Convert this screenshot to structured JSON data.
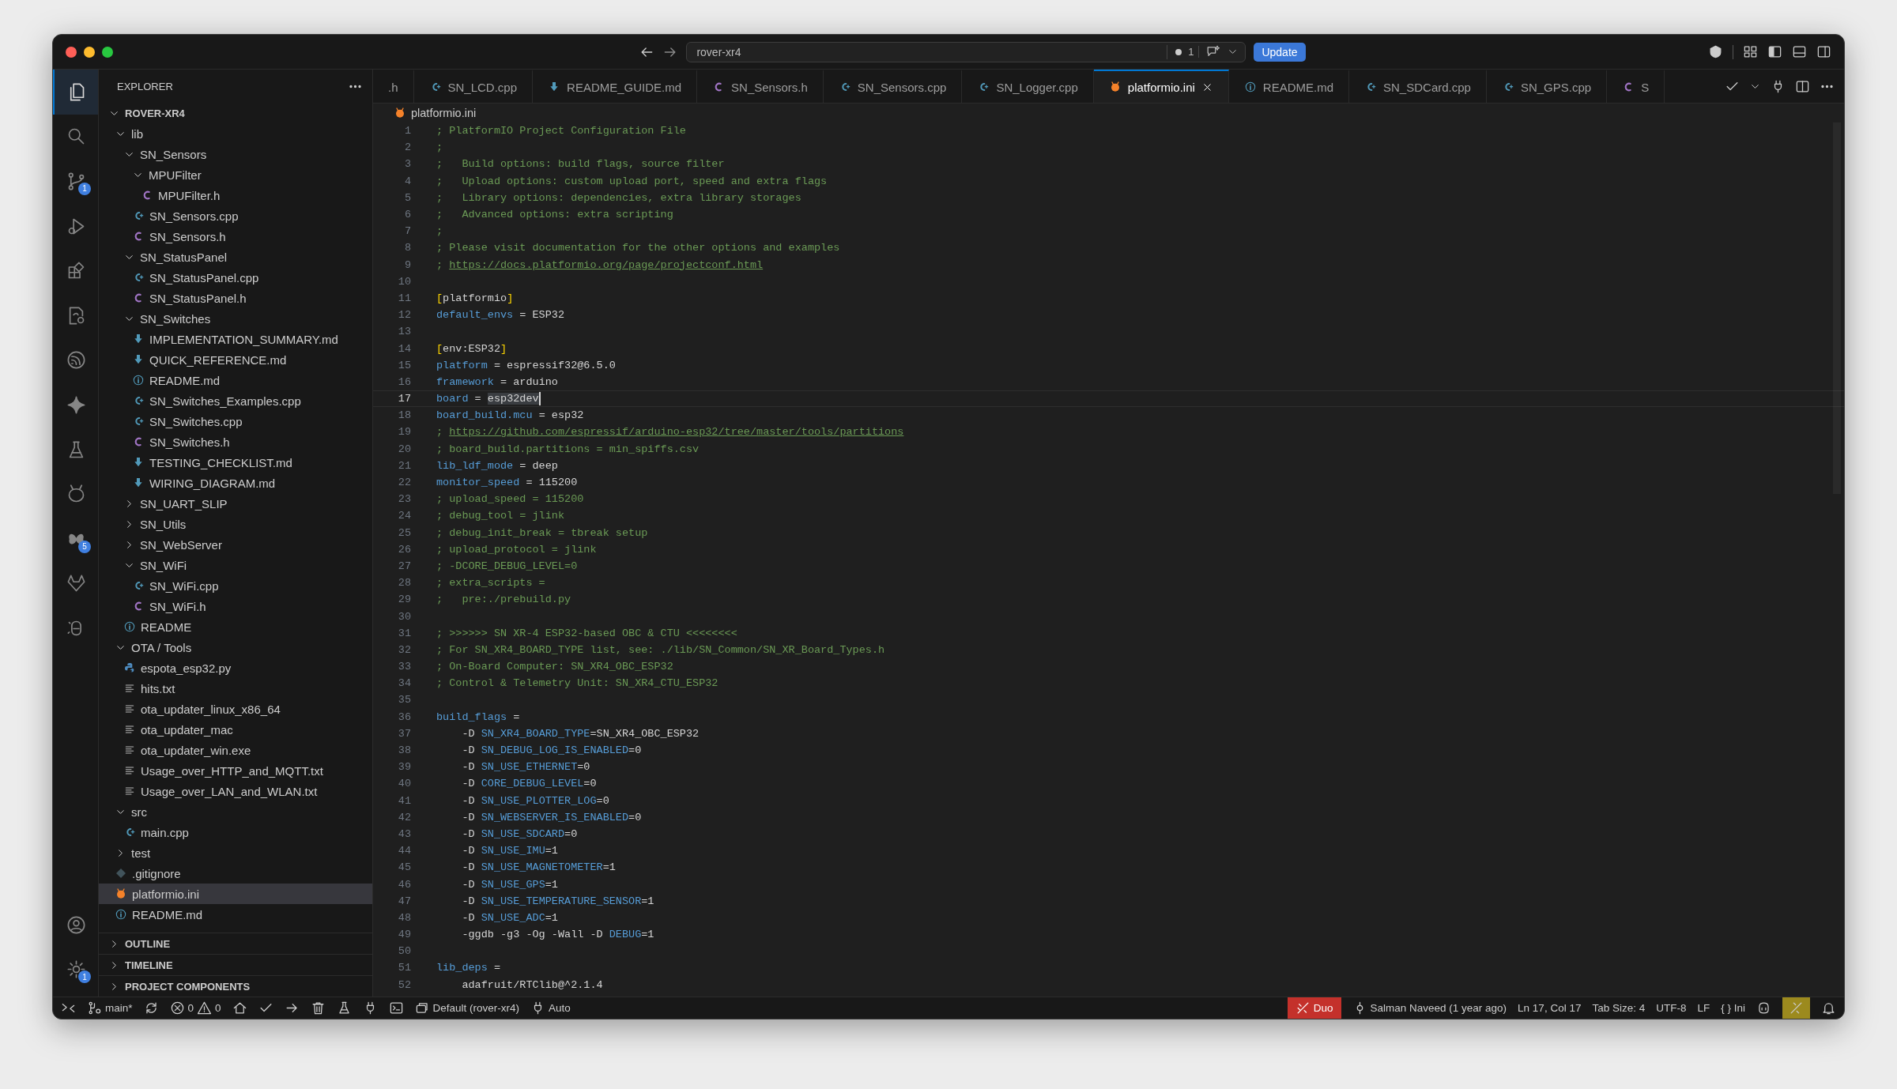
{
  "title_bar": {
    "search": {
      "value": "rover-xr4"
    },
    "changes": "1",
    "update": "Update"
  },
  "activity_bar": {
    "top": [
      {
        "kind": "files",
        "selected": true
      },
      {
        "kind": "search",
        "selected": false
      },
      {
        "kind": "source-control",
        "selected": false,
        "badge": "1"
      },
      {
        "kind": "run",
        "selected": false
      },
      {
        "kind": "extensions",
        "selected": false
      },
      {
        "kind": "remote",
        "selected": false
      },
      {
        "kind": "espressif",
        "selected": false
      },
      {
        "kind": "sparkle",
        "selected": false
      },
      {
        "kind": "flask",
        "selected": false
      },
      {
        "kind": "alien",
        "selected": false
      },
      {
        "kind": "butterfly",
        "selected": false,
        "badge": "5"
      },
      {
        "kind": "fox",
        "selected": false
      },
      {
        "kind": "assistant",
        "selected": false
      }
    ],
    "bottom": [
      {
        "kind": "account",
        "selected": false
      },
      {
        "kind": "settings",
        "selected": false,
        "badge": "1"
      }
    ]
  },
  "explorer": {
    "title": "EXPLORER",
    "root": {
      "name": "ROVER-XR4",
      "expanded": true
    },
    "tree": [
      {
        "name": "lib",
        "kind": "folder",
        "expanded": true,
        "selected": false,
        "children": [
          {
            "name": "SN_Sensors",
            "kind": "folder",
            "expanded": true,
            "selected": false,
            "children": [
              {
                "name": "MPUFilter",
                "kind": "folder",
                "expanded": true,
                "selected": false,
                "children": [
                  {
                    "name": "MPUFilter.h",
                    "kind": "h",
                    "selected": false
                  }
                ]
              },
              {
                "name": "SN_Sensors.cpp",
                "kind": "cpp",
                "selected": false
              },
              {
                "name": "SN_Sensors.h",
                "kind": "h",
                "selected": false
              }
            ]
          },
          {
            "name": "SN_StatusPanel",
            "kind": "folder",
            "expanded": true,
            "selected": false,
            "children": [
              {
                "name": "SN_StatusPanel.cpp",
                "kind": "cpp",
                "selected": false
              },
              {
                "name": "SN_StatusPanel.h",
                "kind": "h",
                "selected": false
              }
            ]
          },
          {
            "name": "SN_Switches",
            "kind": "folder",
            "expanded": true,
            "selected": false,
            "children": [
              {
                "name": "IMPLEMENTATION_SUMMARY.md",
                "kind": "md",
                "selected": false
              },
              {
                "name": "QUICK_REFERENCE.md",
                "kind": "md",
                "selected": false
              },
              {
                "name": "README.md",
                "kind": "info",
                "selected": false
              },
              {
                "name": "SN_Switches_Examples.cpp",
                "kind": "cpp",
                "selected": false
              },
              {
                "name": "SN_Switches.cpp",
                "kind": "cpp",
                "selected": false
              },
              {
                "name": "SN_Switches.h",
                "kind": "h",
                "selected": false
              },
              {
                "name": "TESTING_CHECKLIST.md",
                "kind": "md",
                "selected": false
              },
              {
                "name": "WIRING_DIAGRAM.md",
                "kind": "md",
                "selected": false
              }
            ]
          },
          {
            "name": "SN_UART_SLIP",
            "kind": "folder",
            "expanded": false,
            "selected": false
          },
          {
            "name": "SN_Utils",
            "kind": "folder",
            "expanded": false,
            "selected": false
          },
          {
            "name": "SN_WebServer",
            "kind": "folder",
            "expanded": false,
            "selected": false
          },
          {
            "name": "SN_WiFi",
            "kind": "folder",
            "expanded": true,
            "selected": false,
            "children": [
              {
                "name": "SN_WiFi.cpp",
                "kind": "cpp",
                "selected": false
              },
              {
                "name": "SN_WiFi.h",
                "kind": "h",
                "selected": false
              }
            ]
          },
          {
            "name": "README",
            "kind": "info",
            "selected": false
          }
        ]
      },
      {
        "name": "OTA / Tools",
        "kind": "folder",
        "expanded": true,
        "selected": false,
        "children": [
          {
            "name": "espota_esp32.py",
            "kind": "py",
            "selected": false
          },
          {
            "name": "hits.txt",
            "kind": "txt",
            "selected": false
          },
          {
            "name": "ota_updater_linux_x86_64",
            "kind": "txt",
            "selected": false
          },
          {
            "name": "ota_updater_mac",
            "kind": "txt",
            "selected": false
          },
          {
            "name": "ota_updater_win.exe",
            "kind": "txt",
            "selected": false
          },
          {
            "name": "Usage_over_HTTP_and_MQTT.txt",
            "kind": "txt",
            "selected": false
          },
          {
            "name": "Usage_over_LAN_and_WLAN.txt",
            "kind": "txt",
            "selected": false
          }
        ]
      },
      {
        "name": "src",
        "kind": "folder",
        "expanded": true,
        "selected": false,
        "children": [
          {
            "name": "main.cpp",
            "kind": "cpp",
            "selected": false
          }
        ]
      },
      {
        "name": "test",
        "kind": "folder",
        "expanded": false,
        "selected": false
      },
      {
        "name": ".gitignore",
        "kind": "git",
        "selected": false
      },
      {
        "name": "platformio.ini",
        "kind": "pio",
        "selected": true
      },
      {
        "name": "README.md",
        "kind": "info",
        "selected": false
      }
    ],
    "sections": [
      {
        "label": "OUTLINE",
        "expanded": false
      },
      {
        "label": "TIMELINE",
        "expanded": false
      },
      {
        "label": "PROJECT COMPONENTS",
        "expanded": false
      }
    ]
  },
  "tabs": [
    {
      "label": ".h",
      "selected": false
    },
    {
      "label": "SN_LCD.cpp",
      "kind": "cpp",
      "selected": false
    },
    {
      "label": "README_GUIDE.md",
      "kind": "md",
      "selected": false
    },
    {
      "label": "SN_Sensors.h",
      "kind": "h",
      "selected": false
    },
    {
      "label": "SN_Sensors.cpp",
      "kind": "cpp",
      "selected": false
    },
    {
      "label": "SN_Logger.cpp",
      "kind": "cpp",
      "selected": false
    },
    {
      "label": "platformio.ini",
      "kind": "pio",
      "selected": true
    },
    {
      "label": "README.md",
      "kind": "info",
      "selected": false
    },
    {
      "label": "SN_SDCard.cpp",
      "kind": "cpp",
      "selected": false
    },
    {
      "label": "SN_GPS.cpp",
      "kind": "cpp",
      "selected": false
    },
    {
      "label": "S",
      "kind": "h",
      "selected": false
    }
  ],
  "breadcrumb": {
    "kind": "pio",
    "label": "platformio.ini"
  },
  "code": [
    {
      "n": "1",
      "current": false,
      "tokens": [
        {
          "kind": "comment",
          "text": "; PlatformIO Project Configuration File"
        }
      ]
    },
    {
      "n": "2",
      "current": false,
      "tokens": [
        {
          "kind": "comment",
          "text": ";"
        }
      ]
    },
    {
      "n": "3",
      "current": false,
      "tokens": [
        {
          "kind": "comment",
          "text": ";   Build options: build flags, source filter"
        }
      ]
    },
    {
      "n": "4",
      "current": false,
      "tokens": [
        {
          "kind": "comment",
          "text": ";   Upload options: custom upload port, speed and extra flags"
        }
      ]
    },
    {
      "n": "5",
      "current": false,
      "tokens": [
        {
          "kind": "comment",
          "text": ";   Library options: dependencies, extra library storages"
        }
      ]
    },
    {
      "n": "6",
      "current": false,
      "tokens": [
        {
          "kind": "comment",
          "text": ";   Advanced options: extra scripting"
        }
      ]
    },
    {
      "n": "7",
      "current": false,
      "tokens": [
        {
          "kind": "comment",
          "text": ";"
        }
      ]
    },
    {
      "n": "8",
      "current": false,
      "tokens": [
        {
          "kind": "comment",
          "text": "; Please visit documentation for the other options and examples"
        }
      ]
    },
    {
      "n": "9",
      "current": false,
      "tokens": [
        {
          "kind": "comment",
          "text": "; "
        },
        {
          "kind": "link",
          "text": "https://docs.platformio.org/page/projectconf.html"
        }
      ]
    },
    {
      "n": "10",
      "current": false
    },
    {
      "n": "11",
      "current": false,
      "tokens": [
        {
          "kind": "bracket",
          "text": "["
        },
        {
          "kind": "plain",
          "text": "platformio"
        },
        {
          "kind": "bracket",
          "text": "]"
        }
      ]
    },
    {
      "n": "12",
      "current": false,
      "tokens": [
        {
          "kind": "key",
          "text": "default_envs"
        },
        {
          "kind": "plain",
          "text": " = ESP32"
        }
      ]
    },
    {
      "n": "13",
      "current": false
    },
    {
      "n": "14",
      "current": false,
      "tokens": [
        {
          "kind": "bracket",
          "text": "["
        },
        {
          "kind": "plain",
          "text": "env:ESP32"
        },
        {
          "kind": "bracket",
          "text": "]"
        }
      ]
    },
    {
      "n": "15",
      "current": false,
      "tokens": [
        {
          "kind": "key",
          "text": "platform"
        },
        {
          "kind": "plain",
          "text": " = espressif32@6.5.0"
        }
      ]
    },
    {
      "n": "16",
      "current": false,
      "tokens": [
        {
          "kind": "key",
          "text": "framework"
        },
        {
          "kind": "plain",
          "text": " = arduino"
        }
      ]
    },
    {
      "n": "17",
      "current": true,
      "tokens": [
        {
          "kind": "key",
          "text": "board"
        },
        {
          "kind": "plain",
          "text": " = "
        },
        {
          "kind": "selection",
          "text": "esp32dev"
        }
      ]
    },
    {
      "n": "18",
      "current": false,
      "tokens": [
        {
          "kind": "key",
          "text": "board_build.mcu"
        },
        {
          "kind": "plain",
          "text": " = esp32"
        }
      ]
    },
    {
      "n": "19",
      "current": false,
      "tokens": [
        {
          "kind": "comment",
          "text": "; "
        },
        {
          "kind": "link",
          "text": "https://github.com/espressif/arduino-esp32/tree/master/tools/partitions"
        }
      ]
    },
    {
      "n": "20",
      "current": false,
      "tokens": [
        {
          "kind": "comment",
          "text": "; board_build.partitions = min_spiffs.csv"
        }
      ]
    },
    {
      "n": "21",
      "current": false,
      "tokens": [
        {
          "kind": "key",
          "text": "lib_ldf_mode"
        },
        {
          "kind": "plain",
          "text": " = deep"
        }
      ]
    },
    {
      "n": "22",
      "current": false,
      "tokens": [
        {
          "kind": "key",
          "text": "monitor_speed"
        },
        {
          "kind": "plain",
          "text": " = 115200"
        }
      ]
    },
    {
      "n": "23",
      "current": false,
      "tokens": [
        {
          "kind": "comment",
          "text": "; upload_speed = 115200"
        }
      ]
    },
    {
      "n": "24",
      "current": false,
      "tokens": [
        {
          "kind": "comment",
          "text": "; debug_tool = jlink"
        }
      ]
    },
    {
      "n": "25",
      "current": false,
      "tokens": [
        {
          "kind": "comment",
          "text": "; debug_init_break = tbreak setup"
        }
      ]
    },
    {
      "n": "26",
      "current": false,
      "tokens": [
        {
          "kind": "comment",
          "text": "; upload_protocol = jlink"
        }
      ]
    },
    {
      "n": "27",
      "current": false,
      "tokens": [
        {
          "kind": "comment",
          "text": "; -DCORE_DEBUG_LEVEL=0"
        }
      ]
    },
    {
      "n": "28",
      "current": false,
      "tokens": [
        {
          "kind": "comment",
          "text": "; extra_scripts ="
        }
      ]
    },
    {
      "n": "29",
      "current": false,
      "tokens": [
        {
          "kind": "comment",
          "text": ";   pre:./prebuild.py"
        }
      ]
    },
    {
      "n": "30",
      "current": false
    },
    {
      "n": "31",
      "current": false,
      "tokens": [
        {
          "kind": "comment",
          "text": "; >>>>>> SN XR-4 ESP32-based OBC & CTU <<<<<<<<"
        }
      ]
    },
    {
      "n": "32",
      "current": false,
      "tokens": [
        {
          "kind": "comment",
          "text": "; For SN_XR4_BOARD_TYPE list, see: ./lib/SN_Common/SN_XR_Board_Types.h"
        }
      ]
    },
    {
      "n": "33",
      "current": false,
      "tokens": [
        {
          "kind": "comment",
          "text": "; On-Board Computer: SN_XR4_OBC_ESP32"
        }
      ]
    },
    {
      "n": "34",
      "current": false,
      "tokens": [
        {
          "kind": "comment",
          "text": "; Control & Telemetry Unit: SN_XR4_CTU_ESP32"
        }
      ]
    },
    {
      "n": "35",
      "current": false
    },
    {
      "n": "36",
      "current": false,
      "tokens": [
        {
          "kind": "key",
          "text": "build_flags"
        },
        {
          "kind": "plain",
          "text": " ="
        }
      ]
    },
    {
      "n": "37",
      "current": false,
      "tokens": [
        {
          "kind": "plain",
          "text": "    -D "
        },
        {
          "kind": "key",
          "text": "SN_XR4_BOARD_TYPE"
        },
        {
          "kind": "plain",
          "text": "=SN_XR4_OBC_ESP32"
        }
      ]
    },
    {
      "n": "38",
      "current": false,
      "tokens": [
        {
          "kind": "plain",
          "text": "    -D "
        },
        {
          "kind": "key",
          "text": "SN_DEBUG_LOG_IS_ENABLED"
        },
        {
          "kind": "plain",
          "text": "=0"
        }
      ]
    },
    {
      "n": "39",
      "current": false,
      "tokens": [
        {
          "kind": "plain",
          "text": "    -D "
        },
        {
          "kind": "key",
          "text": "SN_USE_ETHERNET"
        },
        {
          "kind": "plain",
          "text": "=0"
        }
      ]
    },
    {
      "n": "40",
      "current": false,
      "tokens": [
        {
          "kind": "plain",
          "text": "    -D "
        },
        {
          "kind": "key",
          "text": "CORE_DEBUG_LEVEL"
        },
        {
          "kind": "plain",
          "text": "=0"
        }
      ]
    },
    {
      "n": "41",
      "current": false,
      "tokens": [
        {
          "kind": "plain",
          "text": "    -D "
        },
        {
          "kind": "key",
          "text": "SN_USE_PLOTTER_LOG"
        },
        {
          "kind": "plain",
          "text": "=0"
        }
      ]
    },
    {
      "n": "42",
      "current": false,
      "tokens": [
        {
          "kind": "plain",
          "text": "    -D "
        },
        {
          "kind": "key",
          "text": "SN_WEBSERVER_IS_ENABLED"
        },
        {
          "kind": "plain",
          "text": "=0"
        }
      ]
    },
    {
      "n": "43",
      "current": false,
      "tokens": [
        {
          "kind": "plain",
          "text": "    -D "
        },
        {
          "kind": "key",
          "text": "SN_USE_SDCARD"
        },
        {
          "kind": "plain",
          "text": "=0"
        }
      ]
    },
    {
      "n": "44",
      "current": false,
      "tokens": [
        {
          "kind": "plain",
          "text": "    -D "
        },
        {
          "kind": "key",
          "text": "SN_USE_IMU"
        },
        {
          "kind": "plain",
          "text": "=1"
        }
      ]
    },
    {
      "n": "45",
      "current": false,
      "tokens": [
        {
          "kind": "plain",
          "text": "    -D "
        },
        {
          "kind": "key",
          "text": "SN_USE_MAGNETOMETER"
        },
        {
          "kind": "plain",
          "text": "=1"
        }
      ]
    },
    {
      "n": "46",
      "current": false,
      "tokens": [
        {
          "kind": "plain",
          "text": "    -D "
        },
        {
          "kind": "key",
          "text": "SN_USE_GPS"
        },
        {
          "kind": "plain",
          "text": "=1"
        }
      ]
    },
    {
      "n": "47",
      "current": false,
      "tokens": [
        {
          "kind": "plain",
          "text": "    -D "
        },
        {
          "kind": "key",
          "text": "SN_USE_TEMPERATURE_SENSOR"
        },
        {
          "kind": "plain",
          "text": "=1"
        }
      ]
    },
    {
      "n": "48",
      "current": false,
      "tokens": [
        {
          "kind": "plain",
          "text": "    -D "
        },
        {
          "kind": "key",
          "text": "SN_USE_ADC"
        },
        {
          "kind": "plain",
          "text": "=1"
        }
      ]
    },
    {
      "n": "49",
      "current": false,
      "tokens": [
        {
          "kind": "plain",
          "text": "    -ggdb -g3 -Og -Wall -D "
        },
        {
          "kind": "key",
          "text": "DEBUG"
        },
        {
          "kind": "plain",
          "text": "=1"
        }
      ]
    },
    {
      "n": "50",
      "current": false
    },
    {
      "n": "51",
      "current": false,
      "tokens": [
        {
          "kind": "key",
          "text": "lib_deps"
        },
        {
          "kind": "plain",
          "text": " ="
        }
      ]
    },
    {
      "n": "52",
      "current": false,
      "tokens": [
        {
          "kind": "plain",
          "text": "    adafruit/RTClib@^2.1.4"
        }
      ]
    }
  ],
  "status_bar": {
    "left": [
      {
        "kind": "remote"
      },
      {
        "kind": "branch",
        "text": "main*"
      },
      {
        "kind": "sync"
      },
      {
        "kind": "problems",
        "errors": "0",
        "warnings": "0"
      },
      {
        "kind": "home"
      },
      {
        "kind": "check"
      },
      {
        "kind": "arrow"
      },
      {
        "kind": "trash"
      },
      {
        "kind": "flask"
      },
      {
        "kind": "plug"
      },
      {
        "kind": "terminal"
      },
      {
        "kind": "env",
        "text": "Default (rover-xr4)"
      },
      {
        "kind": "port",
        "text": "Auto"
      }
    ],
    "right": [
      {
        "kind": "duo",
        "text": "Duo"
      },
      {
        "kind": "blame",
        "text": "Salman Naveed (1 year ago)"
      },
      {
        "kind": "plain",
        "text": "Ln 17, Col 17"
      },
      {
        "kind": "plain",
        "text": "Tab Size: 4"
      },
      {
        "kind": "plain",
        "text": "UTF-8"
      },
      {
        "kind": "plain",
        "text": "LF"
      },
      {
        "kind": "language",
        "glyph": "{ }",
        "text": "Ini"
      },
      {
        "kind": "copilot"
      },
      {
        "kind": "highlight"
      },
      {
        "kind": "bell"
      }
    ]
  }
}
